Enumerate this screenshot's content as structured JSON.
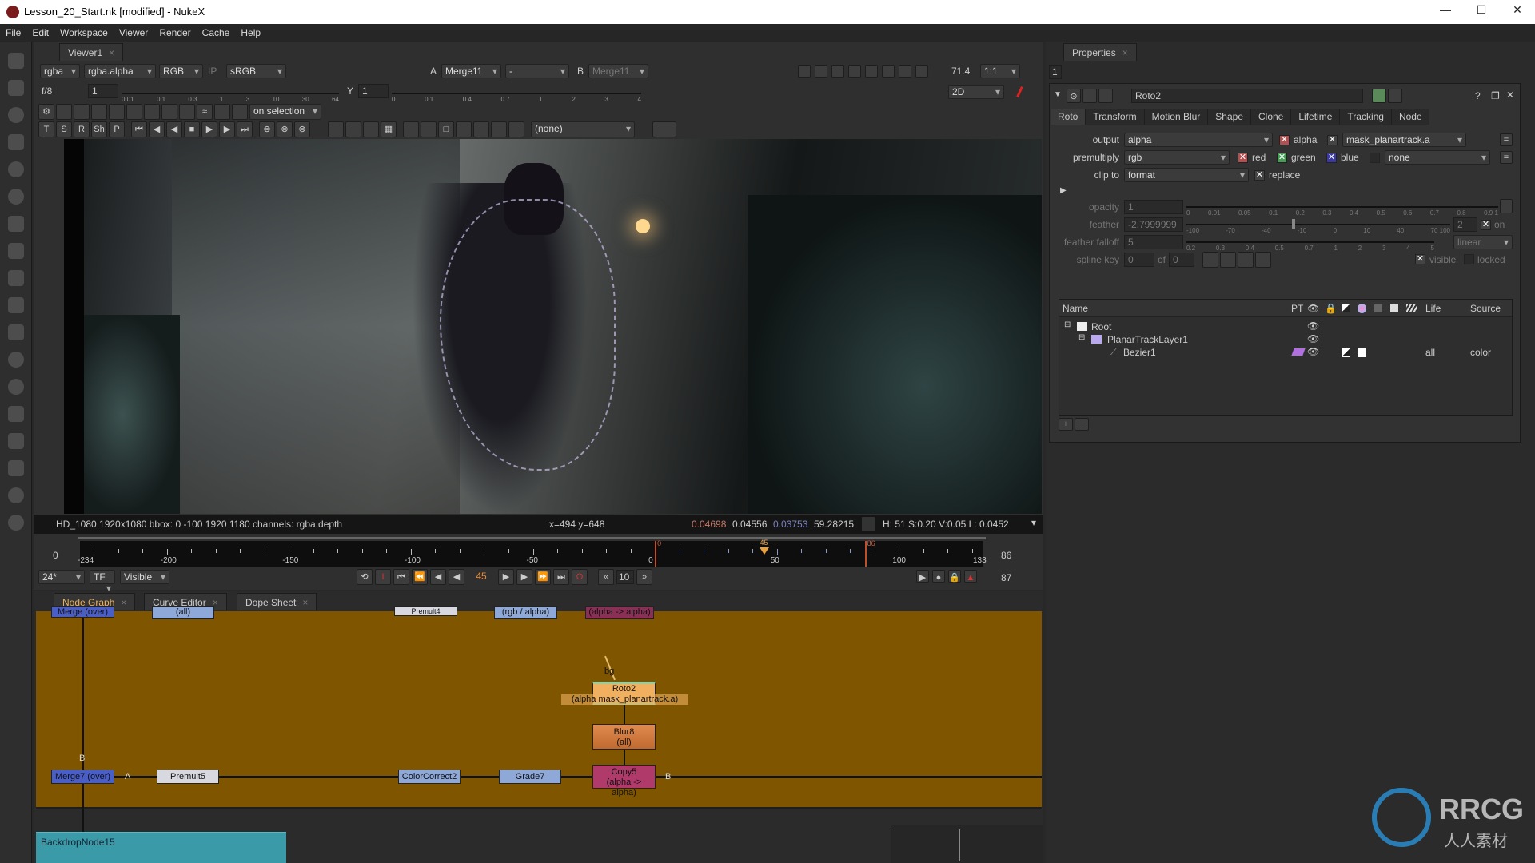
{
  "window": {
    "title": "Lesson_20_Start.nk [modified] - NukeX",
    "minimize": "—",
    "maximize": "☐",
    "close": "✕"
  },
  "menu": [
    "File",
    "Edit",
    "Workspace",
    "Viewer",
    "Render",
    "Cache",
    "Help"
  ],
  "viewer": {
    "tab": "Viewer1",
    "channels": "rgba",
    "alpha": "rgba.alpha",
    "display": "RGB",
    "ip": "IP",
    "lut": "sRGB",
    "a_label": "A",
    "a_input": "Merge11",
    "wipe": "-",
    "b_label": "B",
    "b_input": "Merge11",
    "zoom": "71.4",
    "ratio": "1:1",
    "fstop": "f/8",
    "gain": "1",
    "gain_ticks": [
      "0.01",
      "0.1",
      "0.3",
      "1",
      "3",
      "10",
      "30",
      "64"
    ],
    "y_label": "Y",
    "gamma": "1",
    "gamma_ticks": [
      "0",
      "0.1",
      "0.4",
      "0.7",
      "1",
      "2",
      "3",
      "4"
    ],
    "mode": "2D",
    "on_selection": "on selection",
    "tool_letters": [
      "T",
      "S",
      "R",
      "Sh",
      "P"
    ],
    "none_dropdown": "(none)",
    "info": "HD_1080 1920x1080  bbox: 0 -100 1920 1180 channels: rgba,depth",
    "coords": "x=494 y=648",
    "pixel_r": "0.04698",
    "pixel_g": "0.04556",
    "pixel_b": "0.03753",
    "pixel_a": "59.28215",
    "hsvl": "H: 51 S:0.20 V:0.05  L: 0.0452"
  },
  "timeline": {
    "start": "0",
    "end": "86",
    "ticks": [
      "-234",
      "-200",
      "-150",
      "-100",
      "-50",
      "0",
      "50",
      "100",
      "133"
    ],
    "range_min": -234,
    "range_max": 133,
    "in_point": 0,
    "out_point": 86,
    "current": 45,
    "current_label": "45",
    "in_label": "0",
    "out_label": "86",
    "fps": "24*",
    "tf": "TF",
    "visible": "Visible",
    "frame": "45",
    "step": "10",
    "last_frame": "87"
  },
  "nodegraph": {
    "tabs": [
      "Node Graph",
      "Curve Editor",
      "Dope Sheet"
    ],
    "backdrop_color": "#7f5500",
    "nodes": [
      {
        "name": "Roto2",
        "sub": "(alpha mask_planartrack.a)",
        "color": "#f0b060"
      },
      {
        "name": "Blur8",
        "sub": "(all)",
        "color": "#d9773a"
      },
      {
        "name": "Copy5",
        "sub": "(alpha -> alpha)",
        "color": "#b03a6a"
      },
      {
        "name": "Grade7",
        "sub": "",
        "color": "#8ea8d8"
      },
      {
        "name": "ColorCorrect2",
        "sub": "",
        "color": "#8ea8d8"
      },
      {
        "name": "Premult5",
        "sub": "",
        "color": "#d8d8e0"
      },
      {
        "name": "Merge7 (over)",
        "sub": "",
        "color": "#4a5ec8"
      }
    ],
    "top_nodes": [
      "(all)",
      "Premult4",
      "(rgb / alpha)",
      "(alpha -> alpha)",
      "Merge (over)"
    ],
    "input_labels": {
      "bg": "bg",
      "a": "A",
      "b": "B",
      "b2": "B",
      "a2": "A"
    },
    "backdrop2": "BackdropNode15"
  },
  "properties": {
    "tab": "Properties",
    "count": "1",
    "node_name": "Roto2",
    "tabs": [
      "Roto",
      "Transform",
      "Motion Blur",
      "Shape",
      "Clone",
      "Lifetime",
      "Tracking",
      "Node"
    ],
    "output_label": "output",
    "output": "alpha",
    "alpha_chk": "alpha",
    "mask": "mask_planartrack.a",
    "premult_label": "premultiply",
    "premult": "rgb",
    "red": "red",
    "green": "green",
    "blue": "blue",
    "premult_mask": "none",
    "clip_label": "clip to",
    "clip": "format",
    "replace": "replace",
    "opacity_label": "opacity",
    "opacity": "1",
    "opacity_ticks": [
      "0",
      "0.01",
      "0.05",
      "0.1",
      "0.2",
      "0.3",
      "0.4",
      "0.5",
      "0.6",
      "0.7",
      "0.8",
      "0.9 1"
    ],
    "feather_label": "feather",
    "feather": "-2.7999999",
    "feather_ticks": [
      "-100",
      "-70",
      "-40",
      "-10",
      "0",
      "10",
      "40",
      "70 100"
    ],
    "feather_dim": "2",
    "feather_on": "on",
    "falloff_label": "feather falloff",
    "falloff": "5",
    "falloff_ticks": [
      "0.2",
      "0.3",
      "0.4",
      "0.5",
      "0.7",
      "1",
      "2",
      "3",
      "4",
      "5"
    ],
    "falloff_type": "linear",
    "spline_label": "spline key",
    "spline_key": "0",
    "of": "of",
    "spline_total": "0",
    "visible": "visible",
    "locked": "locked",
    "tree_headers": [
      "Name",
      "PT",
      "Life",
      "Source"
    ],
    "tree": [
      {
        "name": "Root",
        "life": "",
        "source": ""
      },
      {
        "name": "PlanarTrackLayer1",
        "life": "",
        "source": ""
      },
      {
        "name": "Bezier1",
        "life": "all",
        "source": "color"
      }
    ],
    "add": "+",
    "remove": "−"
  },
  "watermark": {
    "brand": "RRCG",
    "sub": "人人素材"
  }
}
